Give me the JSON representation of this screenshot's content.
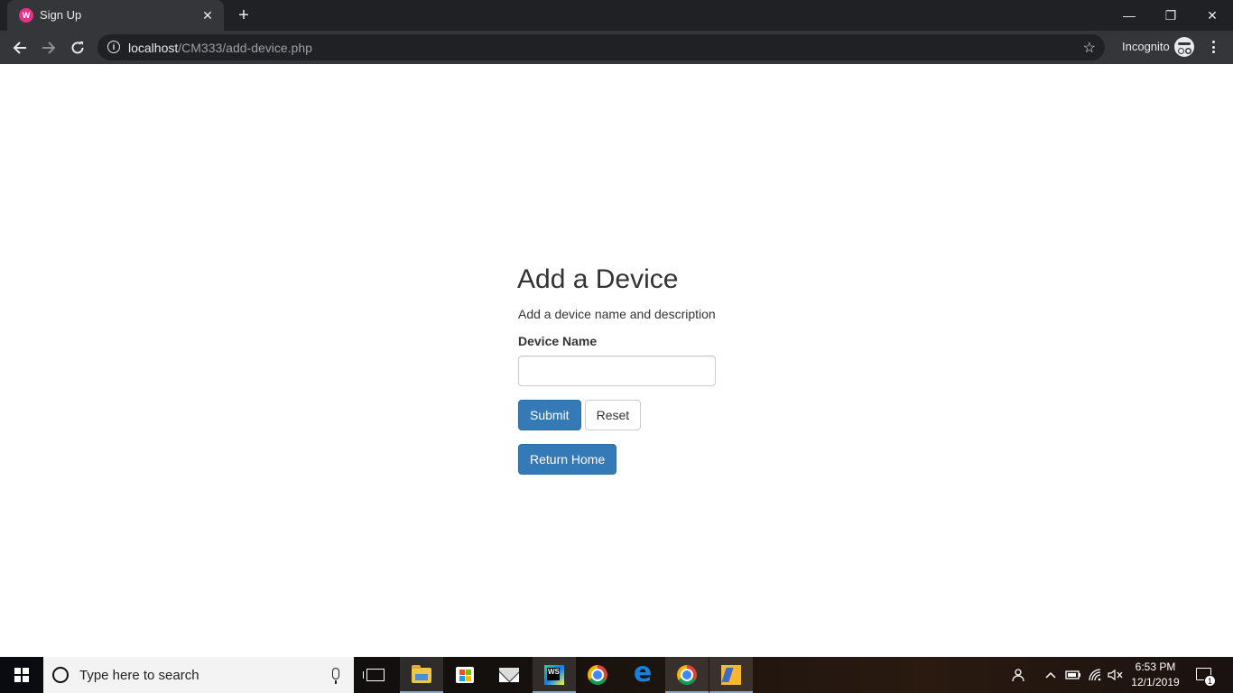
{
  "browser": {
    "tab": {
      "title": "Sign Up",
      "favicon_icon": "webstorm-favicon-icon",
      "favicon_text": "W"
    },
    "window_controls": {
      "minimize_glyph": "—",
      "restore_glyph": "❐",
      "close_glyph": "✕"
    },
    "url": {
      "host": "localhost",
      "path": "/CM333/add-device.php"
    },
    "profile_label": "Incognito"
  },
  "page": {
    "title": "Add a Device",
    "subtitle": "Add a device name and description",
    "form": {
      "device_name_label": "Device Name",
      "device_name_value": "",
      "submit_label": "Submit",
      "reset_label": "Reset"
    },
    "return_home_label": "Return Home"
  },
  "taskbar": {
    "search_placeholder": "Type here to search",
    "pinned_apps": [
      "task-view",
      "file-explorer",
      "microsoft-store",
      "mail",
      "webstorm",
      "google-chrome",
      "microsoft-edge",
      "google-chrome",
      "xampp-control-panel"
    ],
    "active_app": "google-chrome",
    "clock": {
      "time": "6:53 PM",
      "date": "12/1/2019"
    },
    "notification_count": "1"
  },
  "colors": {
    "primary_button": "#337ab7",
    "browser_chrome": "#35363a",
    "tabstrip": "#202124",
    "text": "#333333"
  }
}
